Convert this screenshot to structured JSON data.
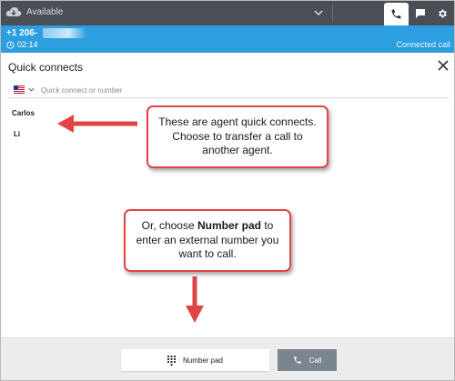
{
  "topbar": {
    "status": "Available",
    "icons": [
      "cloud-icon",
      "chevron-down-icon",
      "phone-icon",
      "chat-icon",
      "gear-icon"
    ]
  },
  "call": {
    "number": "+1 206-",
    "timer": "02:14",
    "status": "Connected call",
    "color": "#2d9ee0"
  },
  "quick_connects": {
    "title": "Quick connects",
    "search_placeholder": "Quick connect or number",
    "contacts": [
      "Carlos",
      "Li"
    ]
  },
  "annotations": {
    "agent_note": "These are agent quick connects. Choose to transfer a call to another agent.",
    "numpad_note_prefix": "Or, choose ",
    "numpad_note_bold": "Number pad",
    "numpad_note_suffix": " to enter an external number you want to call."
  },
  "footer": {
    "numpad_label": "Number pad",
    "call_label": "Call"
  },
  "colors": {
    "topbar": "#4a4e57",
    "accent_red": "#e04545",
    "call_button": "#7b8590"
  }
}
